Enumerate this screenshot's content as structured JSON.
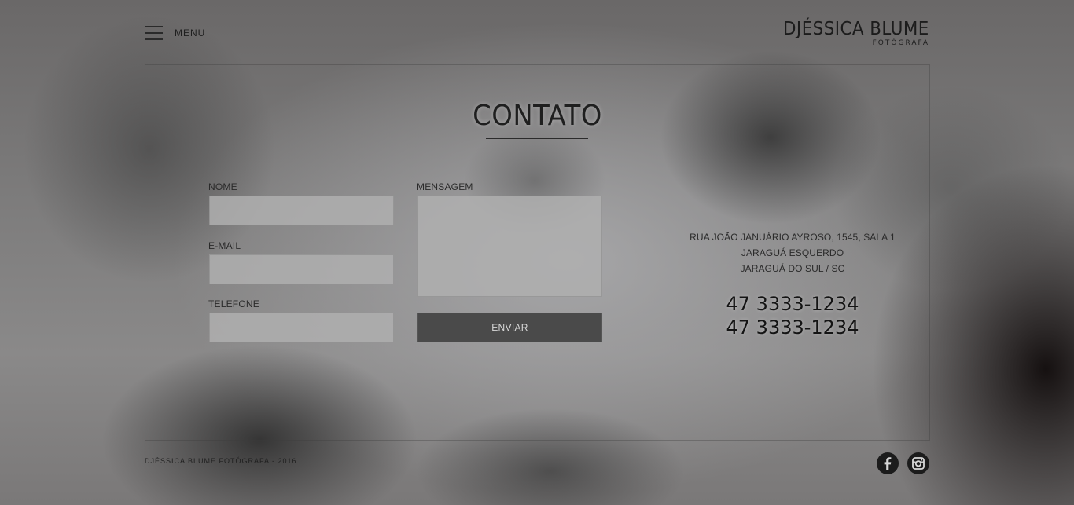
{
  "header": {
    "menu_label": "MENU",
    "logo_name": "DJÉSSICA BLUME",
    "logo_subtitle": "FOTÓGRAFA"
  },
  "contact": {
    "title": "CONTATO",
    "form": {
      "name_label": "NOME",
      "name_value": "",
      "email_label": "E-MAIL",
      "email_value": "",
      "phone_label": "TELEFONE",
      "phone_value": "",
      "message_label": "MENSAGEM",
      "message_value": "",
      "submit_label": "ENVIAR"
    },
    "address": [
      "RUA JOÃO JANUÁRIO AYROSO, 1545, SALA 1",
      "JARAGUÁ ESQUERDO",
      "JARAGUÁ DO SUL / SC"
    ],
    "phones": [
      "47 3333-1234",
      "47 3333-1234"
    ]
  },
  "footer": {
    "copyright": "DJÉSSICA BLUME FOTÓGRAFA - 2016",
    "social": [
      {
        "icon": "facebook-icon"
      },
      {
        "icon": "instagram-icon"
      }
    ]
  }
}
